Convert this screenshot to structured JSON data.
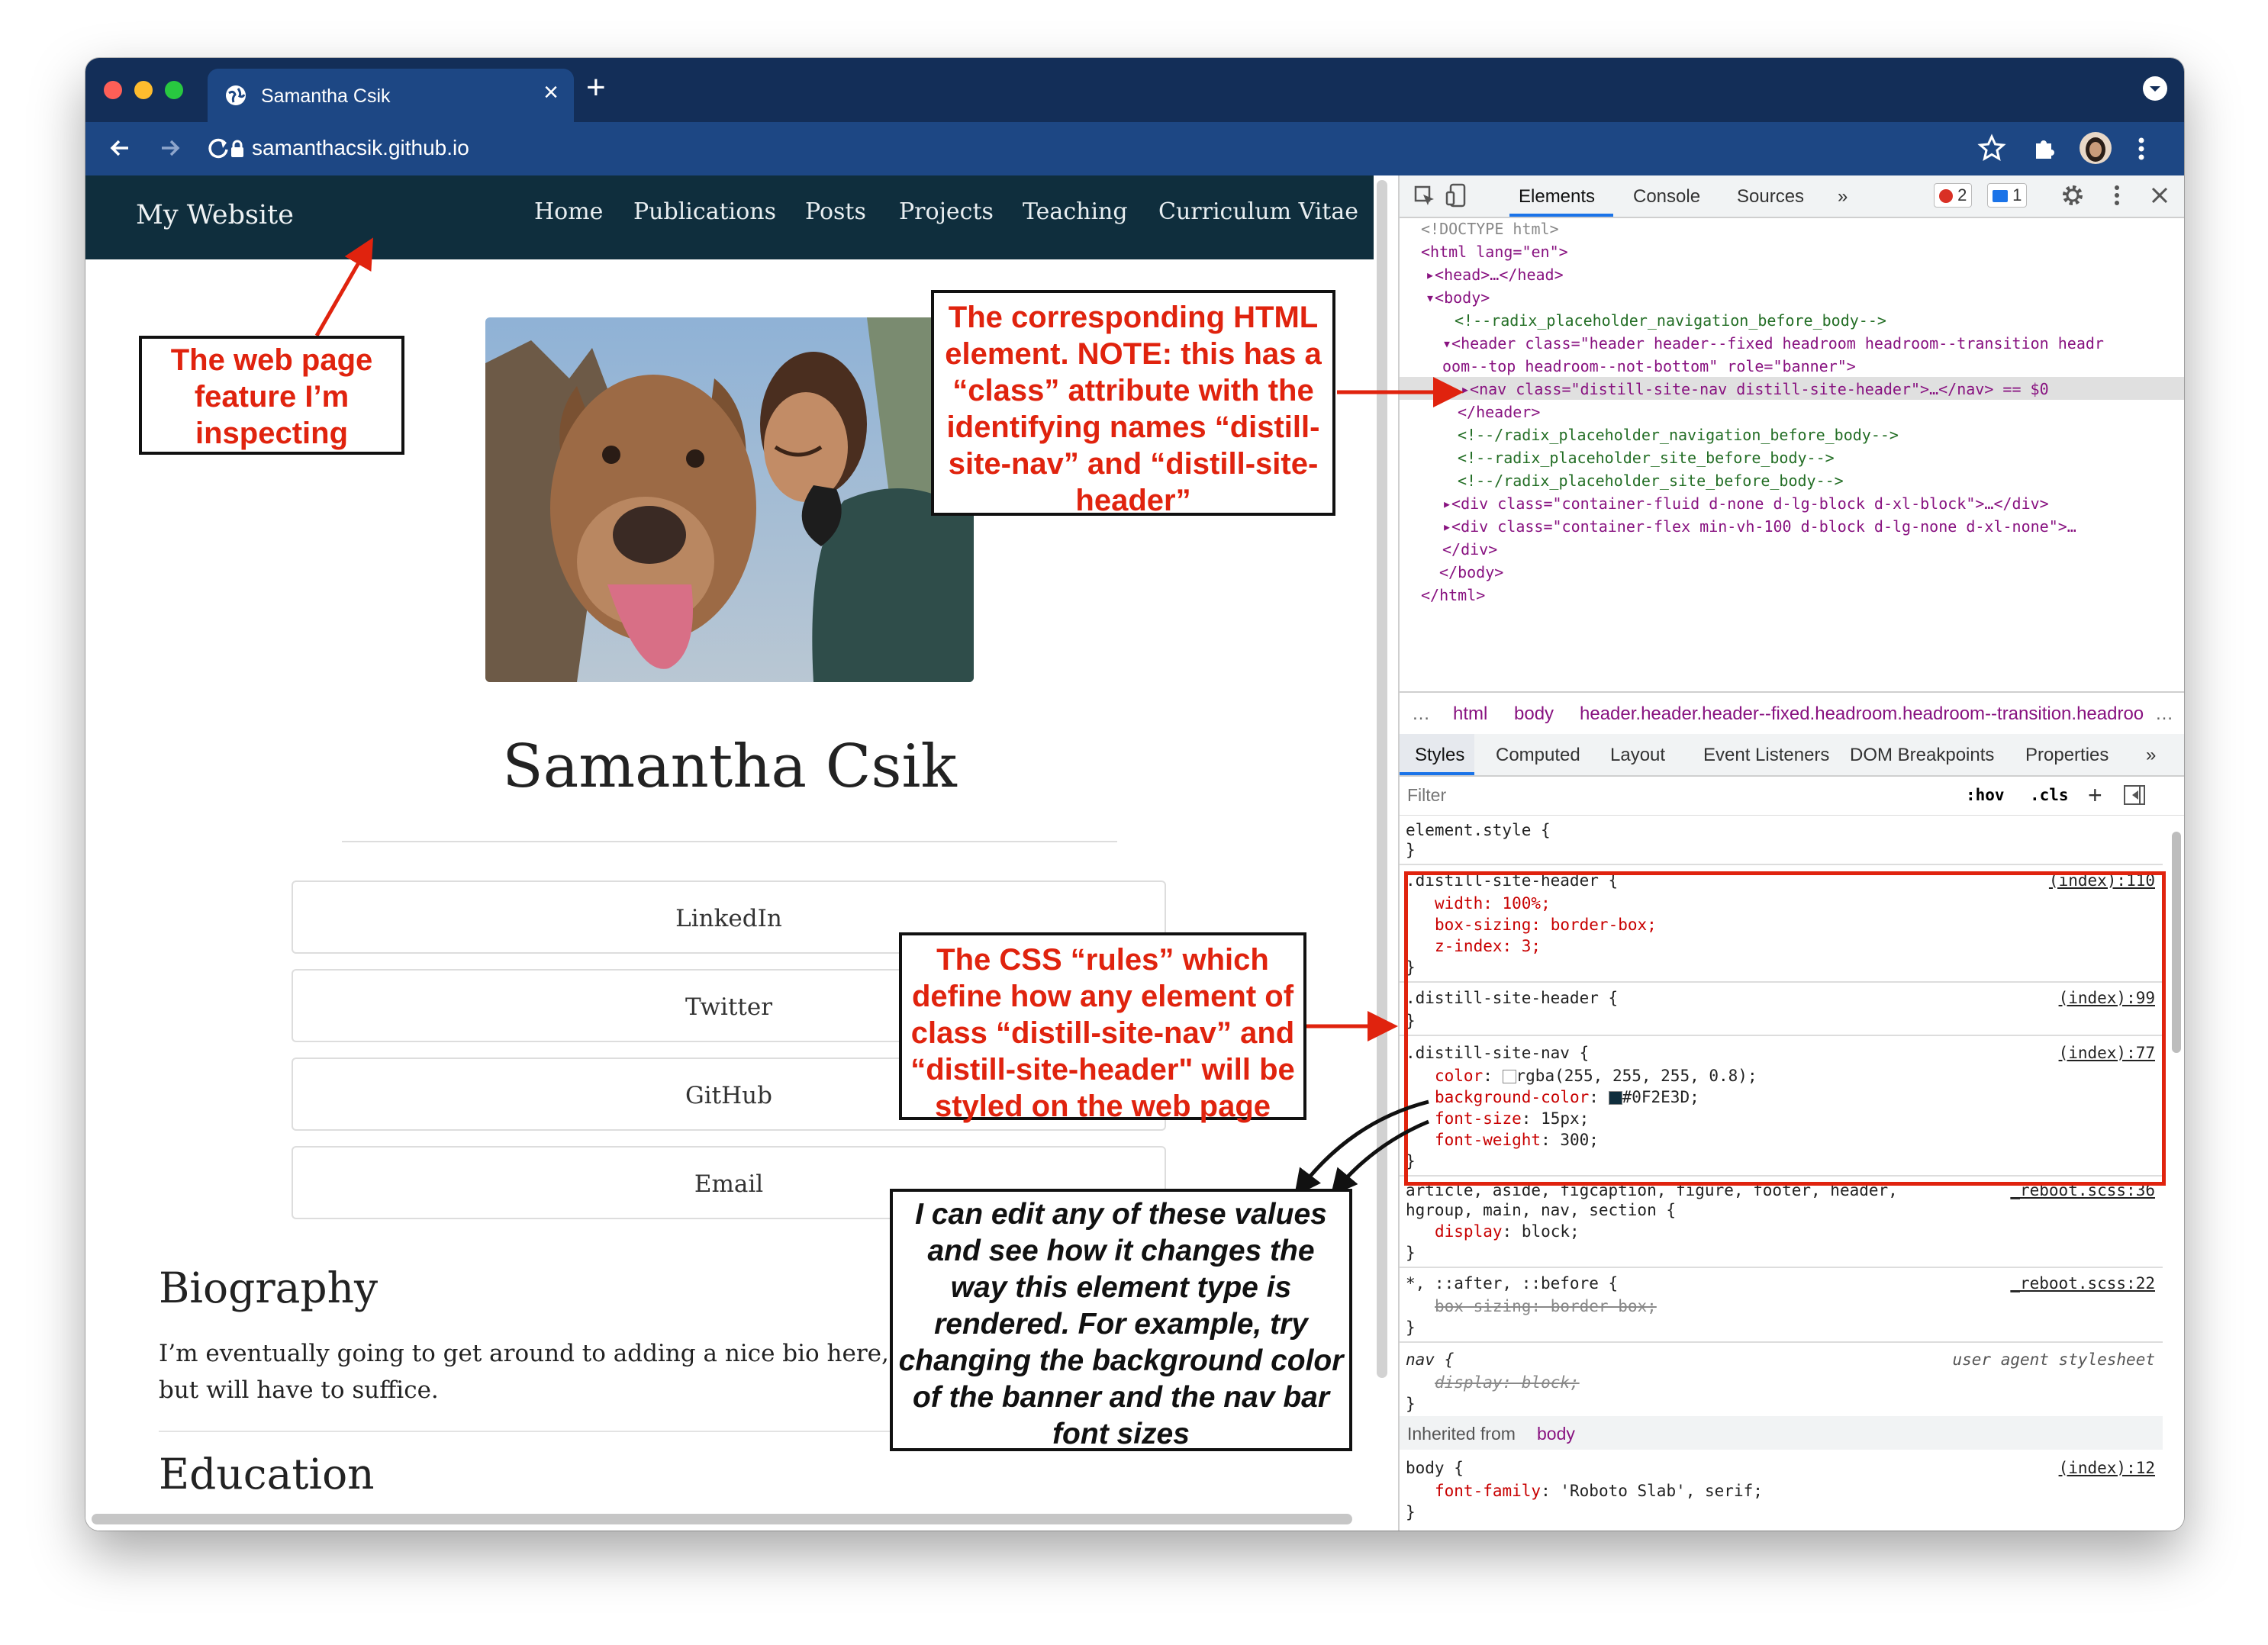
{
  "browser": {
    "tab_title": "Samantha Csik",
    "url": "samanthacsik.github.io",
    "new_tab_symbol": "+",
    "tab_close_symbol": "×"
  },
  "site": {
    "title": "My Website",
    "nav": [
      "Home",
      "Publications",
      "Posts",
      "Projects",
      "Teaching",
      "Curriculum Vitae"
    ],
    "name": "Samantha Csik",
    "links": [
      "LinkedIn",
      "Twitter",
      "GitHub",
      "Email"
    ],
    "biography_heading": "Biography",
    "biography_text": "I’m eventually going to get around to adding a nice bio here, but will have to suffice.",
    "education_heading": "Education"
  },
  "devtools": {
    "tabs": [
      "Elements",
      "Console",
      "Sources",
      "»"
    ],
    "errors_count": "2",
    "messages_count": "1",
    "dom": {
      "doctype": "<!DOCTYPE html>",
      "html_open": "<html lang=\"en\">",
      "head": "<head>…</head>",
      "body_open": "<body>",
      "comment1": "<!--radix_placeholder_navigation_before_body-->",
      "header_line1": "<header class=\"header header--fixed headroom headroom--transition headr",
      "header_line2": "oom--top headroom--not-bottom\" role=\"banner\">",
      "nav_line": "<nav class=\"distill-site-nav distill-site-header\">…</nav> == $0",
      "header_close": "</header>",
      "comment2": "<!--/radix_placeholder_navigation_before_body-->",
      "comment3": "<!--radix_placeholder_site_before_body-->",
      "comment4": "<!--/radix_placeholder_site_before_body-->",
      "div1": "<div class=\"container-fluid d-none d-lg-block d-xl-block\">…</div>",
      "div2": "<div class=\"container-flex min-vh-100 d-block d-lg-none d-xl-none\">…",
      "div_close": "</div>",
      "body_close": "</body>",
      "html_close": "</html>"
    },
    "breadcrumbs": [
      "…",
      "html",
      "body",
      "header.header.header--fixed.headroom.headroom--transition.headroo",
      "…"
    ],
    "style_tabs": [
      "Styles",
      "Computed",
      "Layout",
      "Event Listeners",
      "DOM Breakpoints",
      "Properties",
      "»"
    ],
    "filter_placeholder": "Filter",
    "hov": ":hov",
    "cls": ".cls",
    "rules": {
      "element_style": "element.style {",
      "close": "}",
      "r1_selector": ".distill-site-header {",
      "r1_source": "(index):110",
      "r1_p1": "width: 100%;",
      "r1_p2": "box-sizing: border-box;",
      "r1_p3": "z-index: 3;",
      "r2_selector": ".distill-site-header {",
      "r2_source": "(index):99",
      "r3_selector": ".distill-site-nav {",
      "r3_source": "(index):77",
      "r3_p1_name": "color",
      "r3_p1_value": "rgba(255, 255, 255, 0.8);",
      "r3_p2_name": "background-color",
      "r3_p2_value": "#0F2E3D;",
      "r3_p3_name": "font-size",
      "r3_p3_value": "15px;",
      "r3_p4_name": "font-weight",
      "r3_p4_value": "300;",
      "r4_selector1": "article, aside, figcaption, figure, footer, header,",
      "r4_selector2": "hgroup, main, nav, section {",
      "r4_source": "_reboot.scss:36",
      "r4_p1_name": "display",
      "r4_p1_value": "block;",
      "r5_selector": "*, ::after, ::before {",
      "r5_source": "_reboot.scss:22",
      "r5_p1": "box-sizing: border-box;",
      "r6_selector": "nav {",
      "r6_source": "user agent stylesheet",
      "r6_p1": "display: block;",
      "inherited_label": "Inherited from",
      "inherited_from": "body",
      "r7_selector": "body {",
      "r7_source": "(index):12",
      "r7_p1_name": "font-family",
      "r7_p1_value": "'Roboto Slab', serif;"
    }
  },
  "annotations": {
    "feature": "The web page feature I’m inspecting",
    "html_element": "The corresponding HTML element. NOTE: this has a “class” attribute with the identifying names “distill-site-nav” and “distill-site-header”",
    "css_rules": "The CSS “rules” which define how any element of class “distill-site-nav” and “distill-site-header\" will be styled on the web page",
    "edit_values": "I can edit any of these values and see how it changes the way this element type is rendered. For example, try changing the background color of the banner and the nav bar font sizes"
  },
  "colors": {
    "nav_background": "#0F2E3D",
    "tabbar": "#132e58",
    "toolbar": "#1d4784",
    "annotation_red": "#e0230e"
  },
  "icons": [
    "globe-icon",
    "close-icon",
    "plus-icon",
    "back-icon",
    "forward-icon",
    "reload-icon",
    "lock-icon",
    "star-icon",
    "extensions-icon",
    "avatar",
    "kebab-menu-icon",
    "inspect-icon",
    "device-toggle-icon",
    "gear-icon"
  ]
}
